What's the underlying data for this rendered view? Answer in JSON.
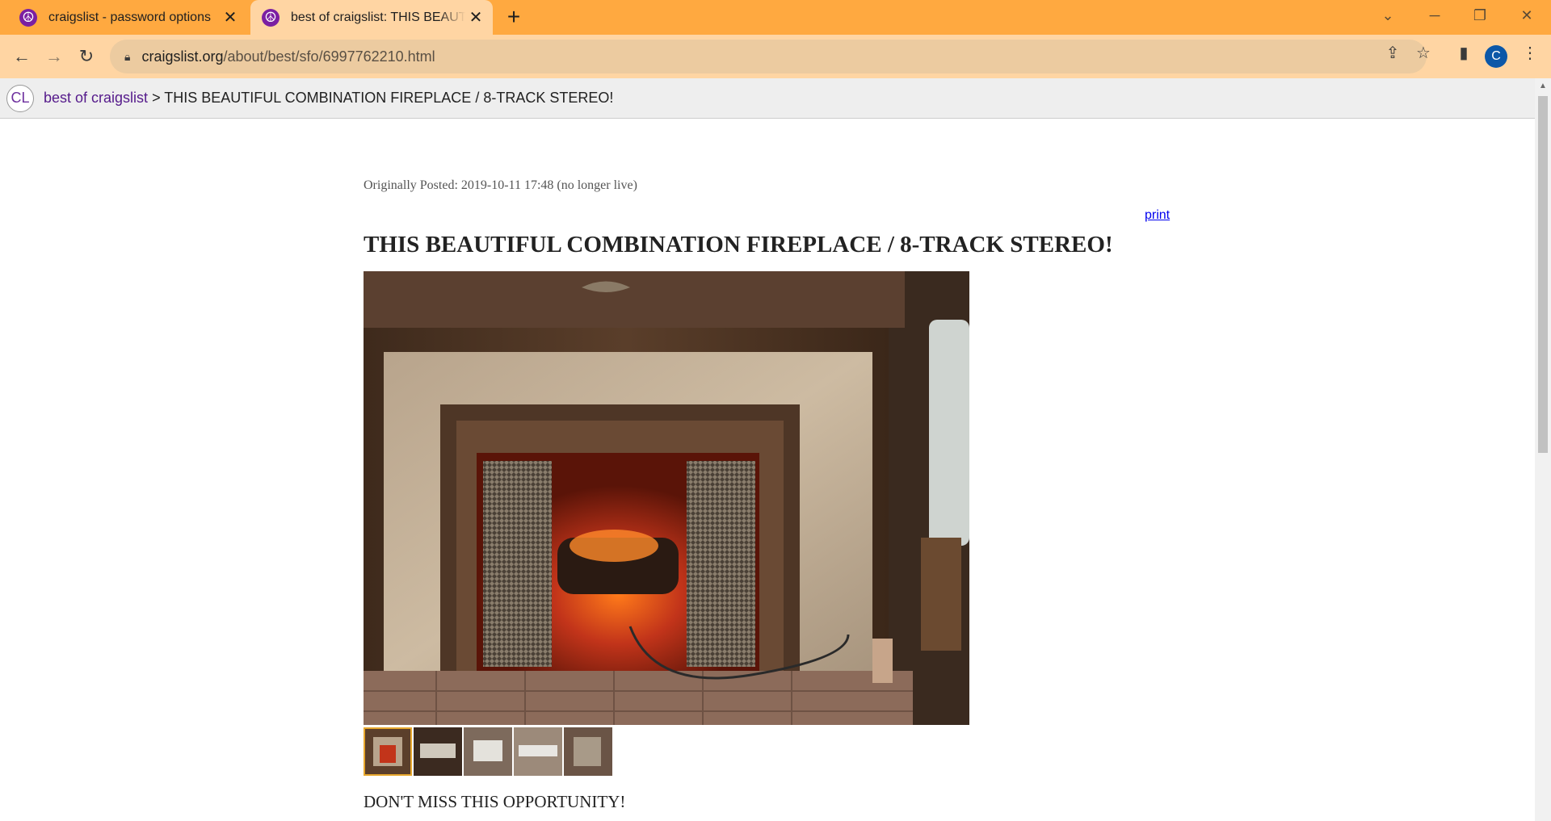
{
  "browser": {
    "tabs": [
      {
        "title": "craigslist - password options",
        "active": false
      },
      {
        "title": "best of craigslist: THIS BEAUTIFUL COMBINATION FIREPLACE / 8-TRACK STEREO!",
        "active": true
      }
    ],
    "url_host": "craigslist.org",
    "url_path": "/about/best/sfo/6997762210.html",
    "profile_initial": "C",
    "tab_color": "#ffa940",
    "toolbar_color": "#ffd5a3"
  },
  "page": {
    "logo_text": "CL",
    "breadcrumb_link": "best of craigslist",
    "breadcrumb_sep": " > ",
    "breadcrumb_current": "THIS BEAUTIFUL COMBINATION FIREPLACE / 8-TRACK STEREO!",
    "posted": "Originally Posted: 2019-10-11 17:48 (no longer live)",
    "print_label": "print",
    "title": "THIS BEAUTIFUL COMBINATION FIREPLACE / 8-TRACK STEREO!",
    "thumbnail_count": 5,
    "selected_thumbnail": 1,
    "body_first_line": "DON'T MISS THIS OPPORTUNITY!"
  }
}
